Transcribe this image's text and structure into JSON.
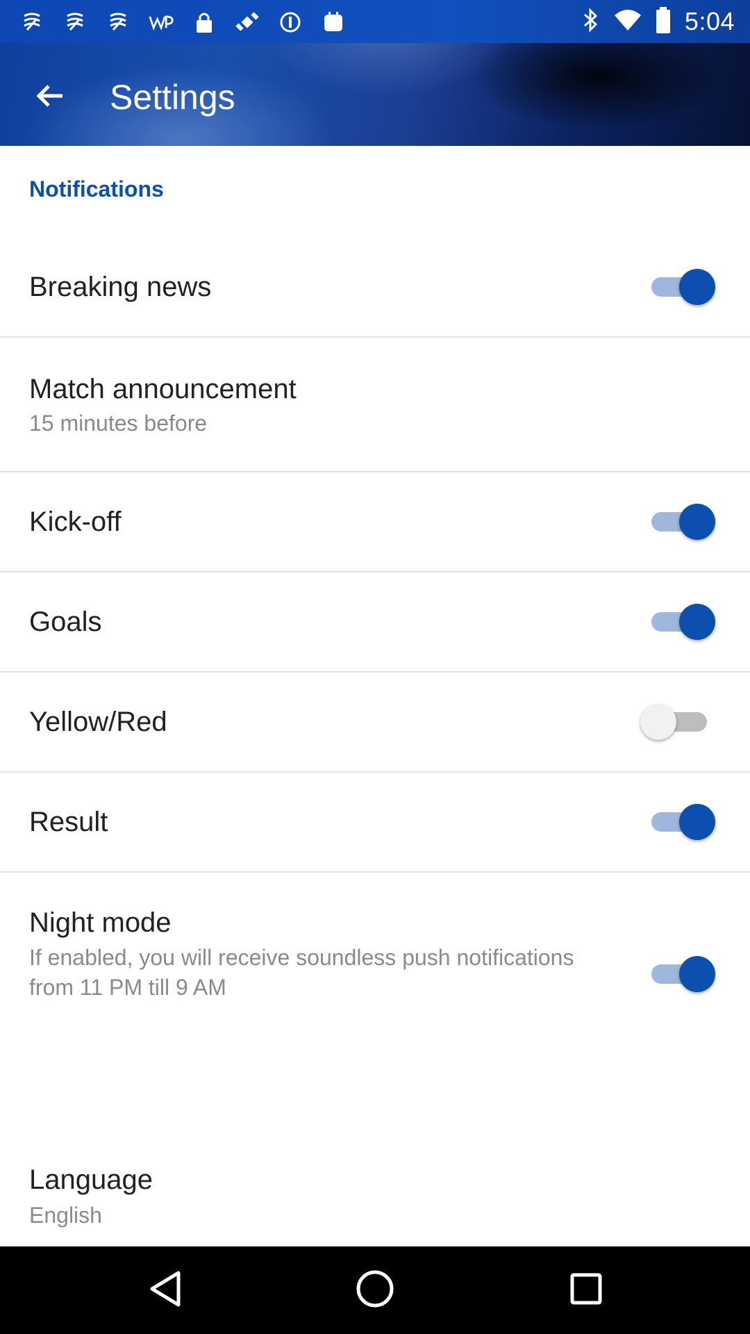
{
  "status_bar": {
    "time": "5:04",
    "left_icons": [
      "notification-icon",
      "notification-icon",
      "notification-icon",
      "washington-post-icon",
      "lock-icon",
      "fake-gps-icon",
      "info-icon",
      "android-debug-icon"
    ],
    "right_icons": [
      "bluetooth-icon",
      "wifi-icon",
      "battery-icon"
    ]
  },
  "app_bar": {
    "title": "Settings",
    "back_icon": "arrow-back-icon"
  },
  "notifications": {
    "header": "Notifications",
    "items": [
      {
        "title": "Breaking news",
        "toggle": true
      },
      {
        "title": "Match announcement",
        "subtitle": "15 minutes before"
      },
      {
        "title": "Kick-off",
        "toggle": true
      },
      {
        "title": "Goals",
        "toggle": true
      },
      {
        "title": "Yellow/Red",
        "toggle": false
      },
      {
        "title": "Result",
        "toggle": true
      },
      {
        "title": "Night mode",
        "subtitle": "If enabled, you will receive soundless push notifications from 11 PM till 9 AM",
        "toggle": true
      }
    ]
  },
  "language": {
    "title": "Language",
    "value": "English"
  },
  "nav_bar": {
    "icons": [
      "back-triangle-icon",
      "home-circle-icon",
      "recents-square-icon"
    ]
  },
  "colors": {
    "accent": "#0d4fae",
    "toggle_track_on": "#9fb7dc",
    "toggle_off_thumb": "#f1f1f1"
  }
}
